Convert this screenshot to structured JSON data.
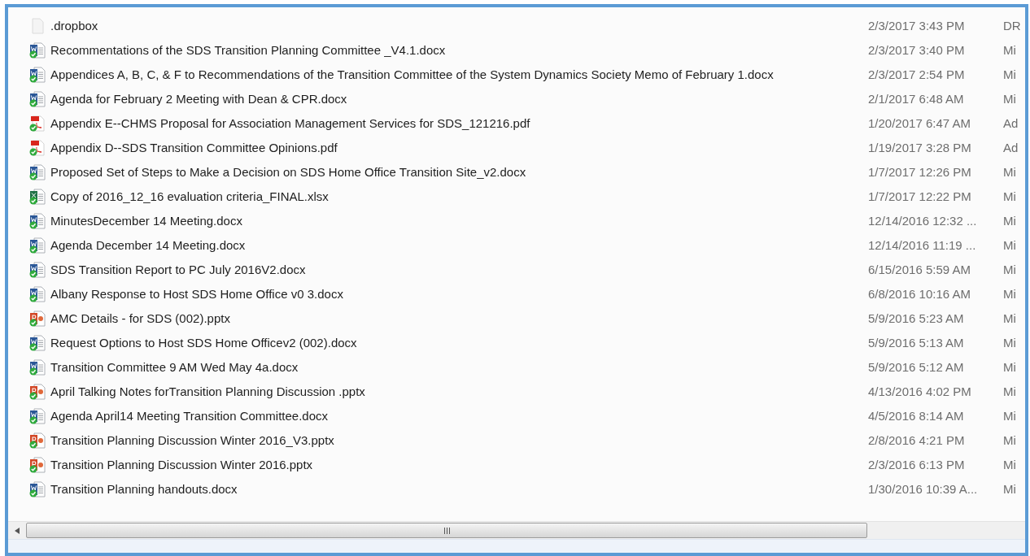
{
  "files": [
    {
      "kind": "blank",
      "name": ".dropbox",
      "date": "2/3/2017 3:43 PM",
      "type": "DR"
    },
    {
      "kind": "word",
      "name": "Recommentations of the SDS Transition Planning Committee _V4.1.docx",
      "date": "2/3/2017 3:40 PM",
      "type": "Mi"
    },
    {
      "kind": "word",
      "name": "Appendices A, B, C, & F to Recommendations of the Transition Committee of the System Dynamics Society Memo of February 1.docx",
      "date": "2/3/2017 2:54 PM",
      "type": "Mi"
    },
    {
      "kind": "word",
      "name": "Agenda for February 2 Meeting with Dean & CPR.docx",
      "date": "2/1/2017 6:48 AM",
      "type": "Mi"
    },
    {
      "kind": "pdf",
      "name": "Appendix E--CHMS Proposal for Association Management Services for SDS_121216.pdf",
      "date": "1/20/2017 6:47 AM",
      "type": "Ad"
    },
    {
      "kind": "pdf",
      "name": "Appendix D--SDS Transition Committee Opinions.pdf",
      "date": "1/19/2017 3:28 PM",
      "type": "Ad"
    },
    {
      "kind": "word",
      "name": "Proposed Set of Steps to Make a Decision on SDS Home Office Transition Site_v2.docx",
      "date": "1/7/2017 12:26 PM",
      "type": "Mi"
    },
    {
      "kind": "excel",
      "name": "Copy of 2016_12_16 evaluation criteria_FINAL.xlsx",
      "date": "1/7/2017 12:22 PM",
      "type": "Mi"
    },
    {
      "kind": "word",
      "name": "MinutesDecember 14 Meeting.docx",
      "date": "12/14/2016 12:32 ...",
      "type": "Mi"
    },
    {
      "kind": "word",
      "name": "Agenda December 14 Meeting.docx",
      "date": "12/14/2016 11:19 ...",
      "type": "Mi"
    },
    {
      "kind": "word",
      "name": "SDS Transition Report to PC July 2016V2.docx",
      "date": "6/15/2016 5:59 AM",
      "type": "Mi"
    },
    {
      "kind": "word",
      "name": "Albany Response to Host SDS Home Office v0 3.docx",
      "date": "6/8/2016 10:16 AM",
      "type": "Mi"
    },
    {
      "kind": "powerpoint",
      "name": "AMC Details - for SDS (002).pptx",
      "date": "5/9/2016 5:23 AM",
      "type": "Mi"
    },
    {
      "kind": "word",
      "name": "Request Options to Host SDS Home Officev2 (002).docx",
      "date": "5/9/2016 5:13 AM",
      "type": "Mi"
    },
    {
      "kind": "word",
      "name": "Transition Committee 9 AM Wed May 4a.docx",
      "date": "5/9/2016 5:12 AM",
      "type": "Mi"
    },
    {
      "kind": "powerpoint",
      "name": "April Talking Notes forTransition Planning Discussion .pptx",
      "date": "4/13/2016 4:02 PM",
      "type": "Mi"
    },
    {
      "kind": "word",
      "name": "Agenda April14 Meeting Transition Committee.docx",
      "date": "4/5/2016 8:14 AM",
      "type": "Mi"
    },
    {
      "kind": "powerpoint",
      "name": "Transition Planning Discussion Winter 2016_V3.pptx",
      "date": "2/8/2016 4:21 PM",
      "type": "Mi"
    },
    {
      "kind": "powerpoint",
      "name": "Transition Planning Discussion Winter 2016.pptx",
      "date": "2/3/2016 6:13 PM",
      "type": "Mi"
    },
    {
      "kind": "word",
      "name": "Transition  Planning handouts.docx",
      "date": "1/30/2016 10:39 A...",
      "type": "Mi"
    }
  ]
}
